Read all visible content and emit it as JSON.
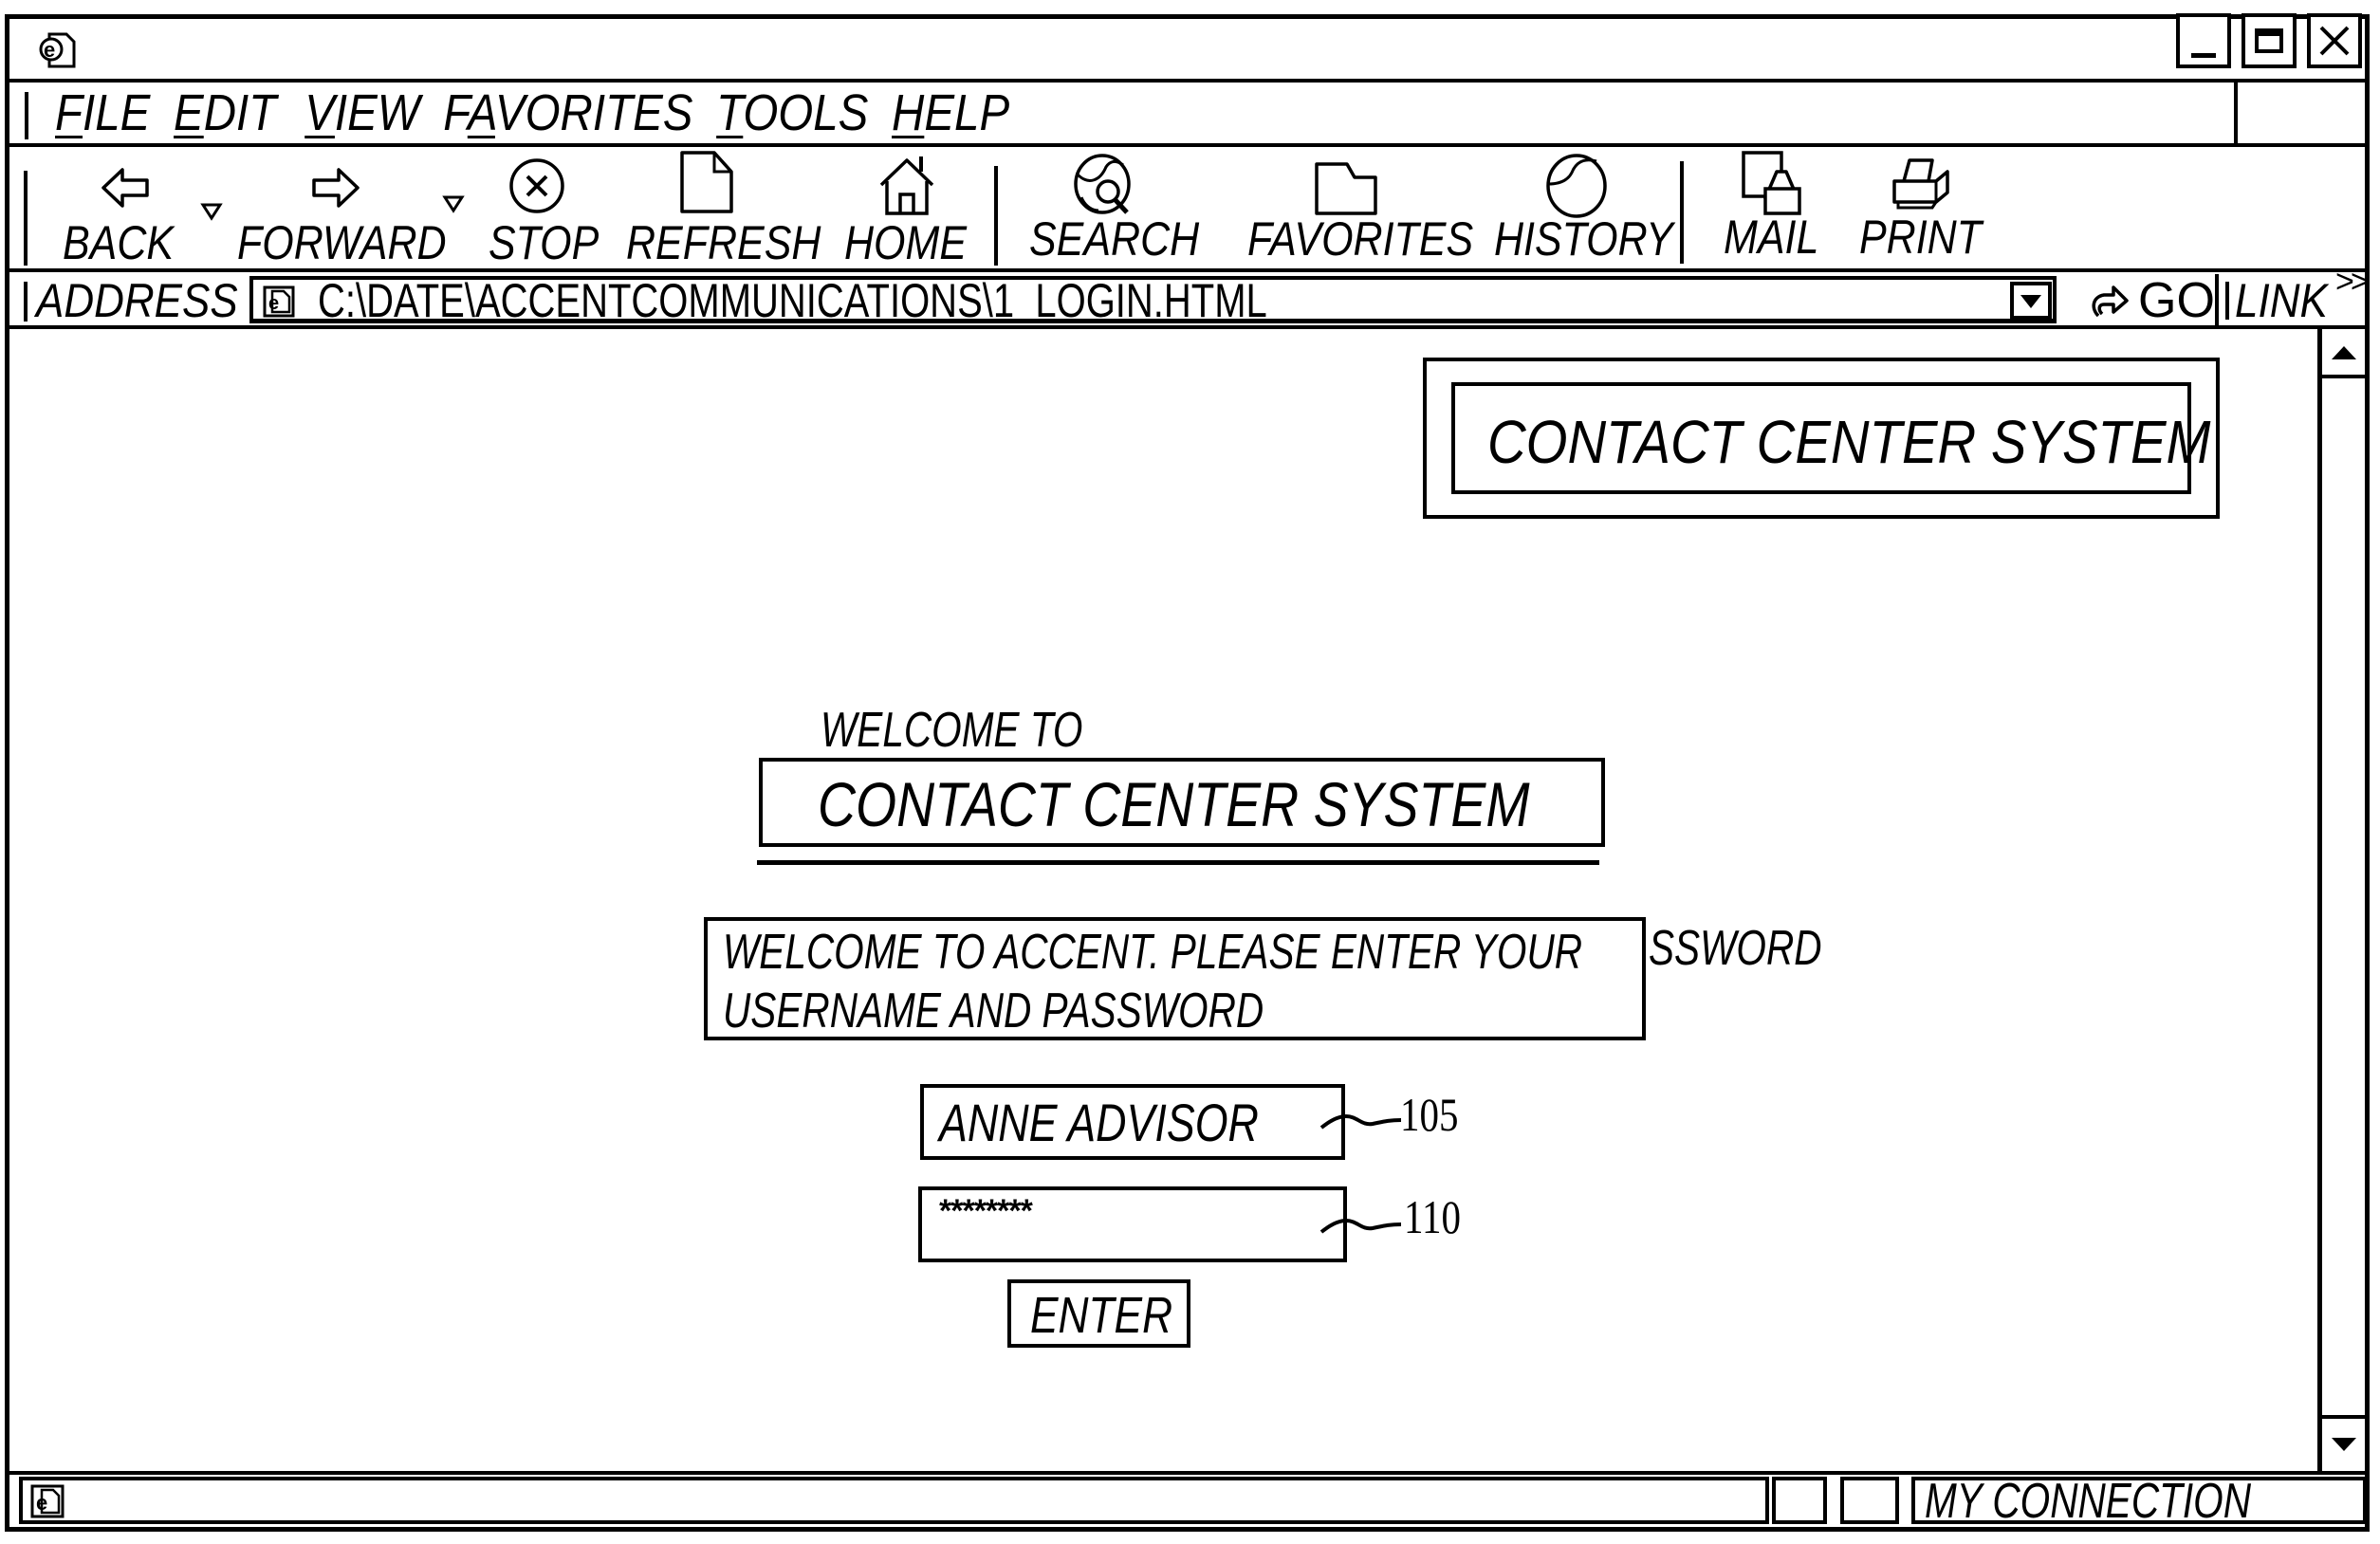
{
  "window": {
    "title_icon": "ie-page-icon",
    "controls": {
      "minimize": "minimize-icon",
      "maximize": "maximize-icon",
      "close": "close-icon"
    }
  },
  "menu": {
    "items": [
      {
        "label": "FILE",
        "accel": "F",
        "rest": "ILE"
      },
      {
        "label": "EDIT",
        "accel": "E",
        "rest": "DIT"
      },
      {
        "label": "VIEW",
        "accel": "V",
        "rest": "IEW"
      },
      {
        "label": "FAVORITES",
        "accel": "F",
        "rest": "AVORITES",
        "accel_index": 1
      },
      {
        "label": "TOOLS",
        "accel": "T",
        "rest": "OOLS"
      },
      {
        "label": "HELP",
        "accel": "H",
        "rest": "ELP"
      }
    ]
  },
  "toolbar": {
    "buttons": [
      {
        "label": "BACK",
        "icon": "back-arrow-icon",
        "has_dropdown": true
      },
      {
        "label": "FORWARD",
        "icon": "forward-arrow-icon",
        "has_dropdown": true
      },
      {
        "label": "STOP",
        "icon": "stop-icon"
      },
      {
        "label": "REFRESH",
        "icon": "refresh-page-icon"
      },
      {
        "label": "HOME",
        "icon": "home-icon"
      },
      {
        "label": "SEARCH",
        "icon": "search-globe-icon"
      },
      {
        "label": "FAVORITES",
        "icon": "favorites-folder-icon"
      },
      {
        "label": "HISTORY",
        "icon": "history-globe-icon"
      },
      {
        "label": "MAIL",
        "icon": "mail-icon"
      },
      {
        "label": "PRINT",
        "icon": "printer-icon"
      }
    ]
  },
  "address_bar": {
    "label": "ADDRESS",
    "value": "C:\\DATE\\ACCENTCOMMUNICATIONS\\1  LOGIN.HTML",
    "go_label": "GO",
    "links_label": "LINK",
    "links_chevron": ">>"
  },
  "page": {
    "header_banner": "CONTACT CENTER SYSTEM",
    "welcome_to": "WELCOME TO",
    "title": "CONTACT CENTER SYSTEM",
    "message_line1": "WELCOME TO ACCENT. PLEASE ENTER YOUR",
    "message_line2": "USERNAME AND PASSWORD",
    "message_overflow": "SSWORD",
    "username_value": "ANNE ADVISOR",
    "password_value": "********",
    "enter_label": "ENTER",
    "ref_username": "105",
    "ref_password": "110"
  },
  "status_bar": {
    "connection": "MY CONNECTION"
  }
}
